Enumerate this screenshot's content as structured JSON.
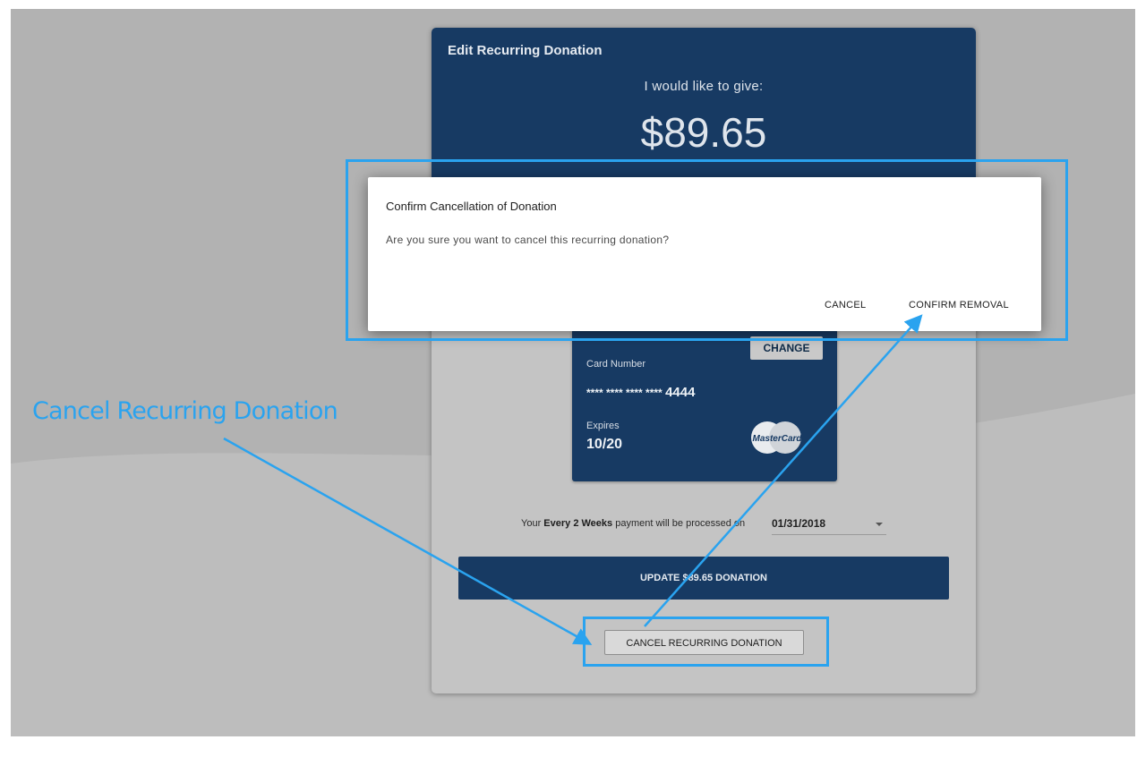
{
  "donation": {
    "title": "Edit Recurring Donation",
    "give_label": "I would like to give:",
    "amount": "$89.65",
    "change_label": "CHANGE",
    "card": {
      "number_label": "Card Number",
      "masked_digits": "**** **** **** ****",
      "last4": "4444",
      "expires_label": "Expires",
      "expiry": "10/20",
      "brand": "MasterCard"
    },
    "schedule": {
      "prefix": "Your",
      "frequency": "Every 2 Weeks",
      "suffix": "payment will be processed on",
      "date": "01/31/2018"
    },
    "update_button": "UPDATE $89.65 DONATION",
    "cancel_recurring_button": "CANCEL RECURRING DONATION"
  },
  "dialog": {
    "title": "Confirm Cancellation of Donation",
    "body": "Are you sure you want to cancel this recurring donation?",
    "cancel_button": "CANCEL",
    "confirm_button": "CONFIRM REMOVAL"
  },
  "annotation": {
    "label": "Cancel Recurring Donation",
    "color": "#2aa3ef"
  },
  "colors": {
    "brand_navy": "#173a63",
    "background_gray": "#bdbdbd"
  }
}
